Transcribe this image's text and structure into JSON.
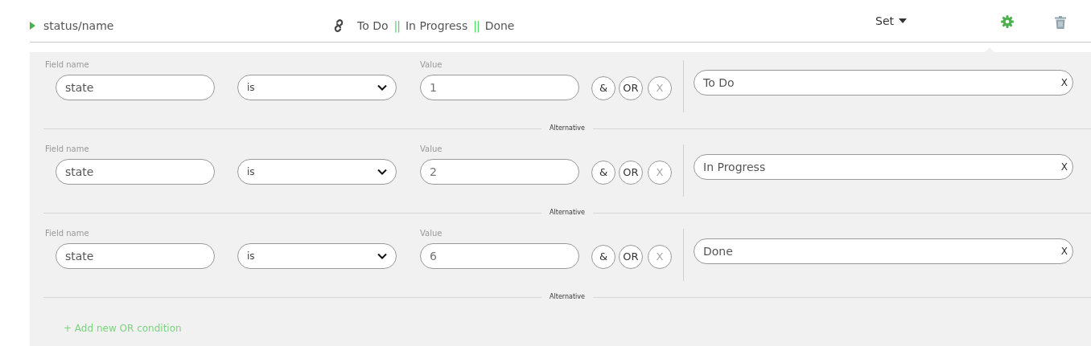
{
  "header": {
    "name": "status/name",
    "mapping": [
      {
        "kind": "value",
        "text": "To Do"
      },
      {
        "kind": "separator",
        "text": "||"
      },
      {
        "kind": "value",
        "text": "In Progress"
      },
      {
        "kind": "separator",
        "text": "||"
      },
      {
        "kind": "value",
        "text": "Done"
      }
    ],
    "mode": "Set"
  },
  "conditions": [
    {
      "field_label": "Field name",
      "field": "state",
      "operator": "is",
      "value_label": "Value",
      "value": "1",
      "buttons": [
        "&",
        "OR",
        "X"
      ],
      "result": "To Do",
      "clear": "X",
      "divider_label": "Alternative"
    },
    {
      "field_label": "Field name",
      "field": "state",
      "operator": "is",
      "value_label": "Value",
      "value": "2",
      "buttons": [
        "&",
        "OR",
        "X"
      ],
      "result": "In Progress",
      "clear": "X",
      "divider_label": "Alternative"
    },
    {
      "field_label": "Field name",
      "field": "state",
      "operator": "is",
      "value_label": "Value",
      "value": "6",
      "buttons": [
        "&",
        "OR",
        "X"
      ],
      "result": "Done",
      "clear": "X",
      "divider_label": "Alternative"
    }
  ],
  "add_link": "+ Add new OR condition"
}
